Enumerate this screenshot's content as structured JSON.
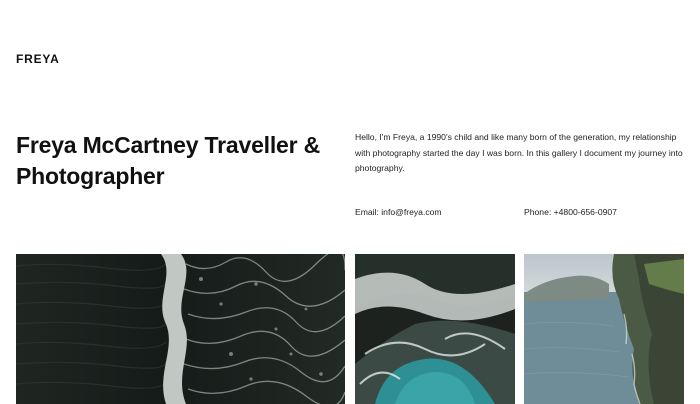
{
  "header": {
    "logo": "FREYA"
  },
  "hero": {
    "title": "Freya McCartney Traveller & Photographer",
    "intro": "Hello, I'm Freya, a 1990's child and like many born of the generation, my relationship with photography started the day I was born. In this gallery I document my journey into photography.",
    "email": "Email: info@freya.com",
    "phone": "Phone: +4800-656-0907"
  },
  "gallery": {
    "photos": [
      {
        "subject": "aerial-dark-ocean-waves"
      },
      {
        "subject": "aerial-rocky-shore-surf"
      },
      {
        "subject": "coastal-cliffs-sea"
      }
    ]
  },
  "colors": {
    "background": "#ffffff",
    "text": "#111111",
    "ocean_dark": "#1a211e",
    "surf": "#e6ebe8",
    "lagoon": "#2e8f95",
    "cliff_sea": "#6f8d98",
    "sky": "#c5ced3"
  }
}
